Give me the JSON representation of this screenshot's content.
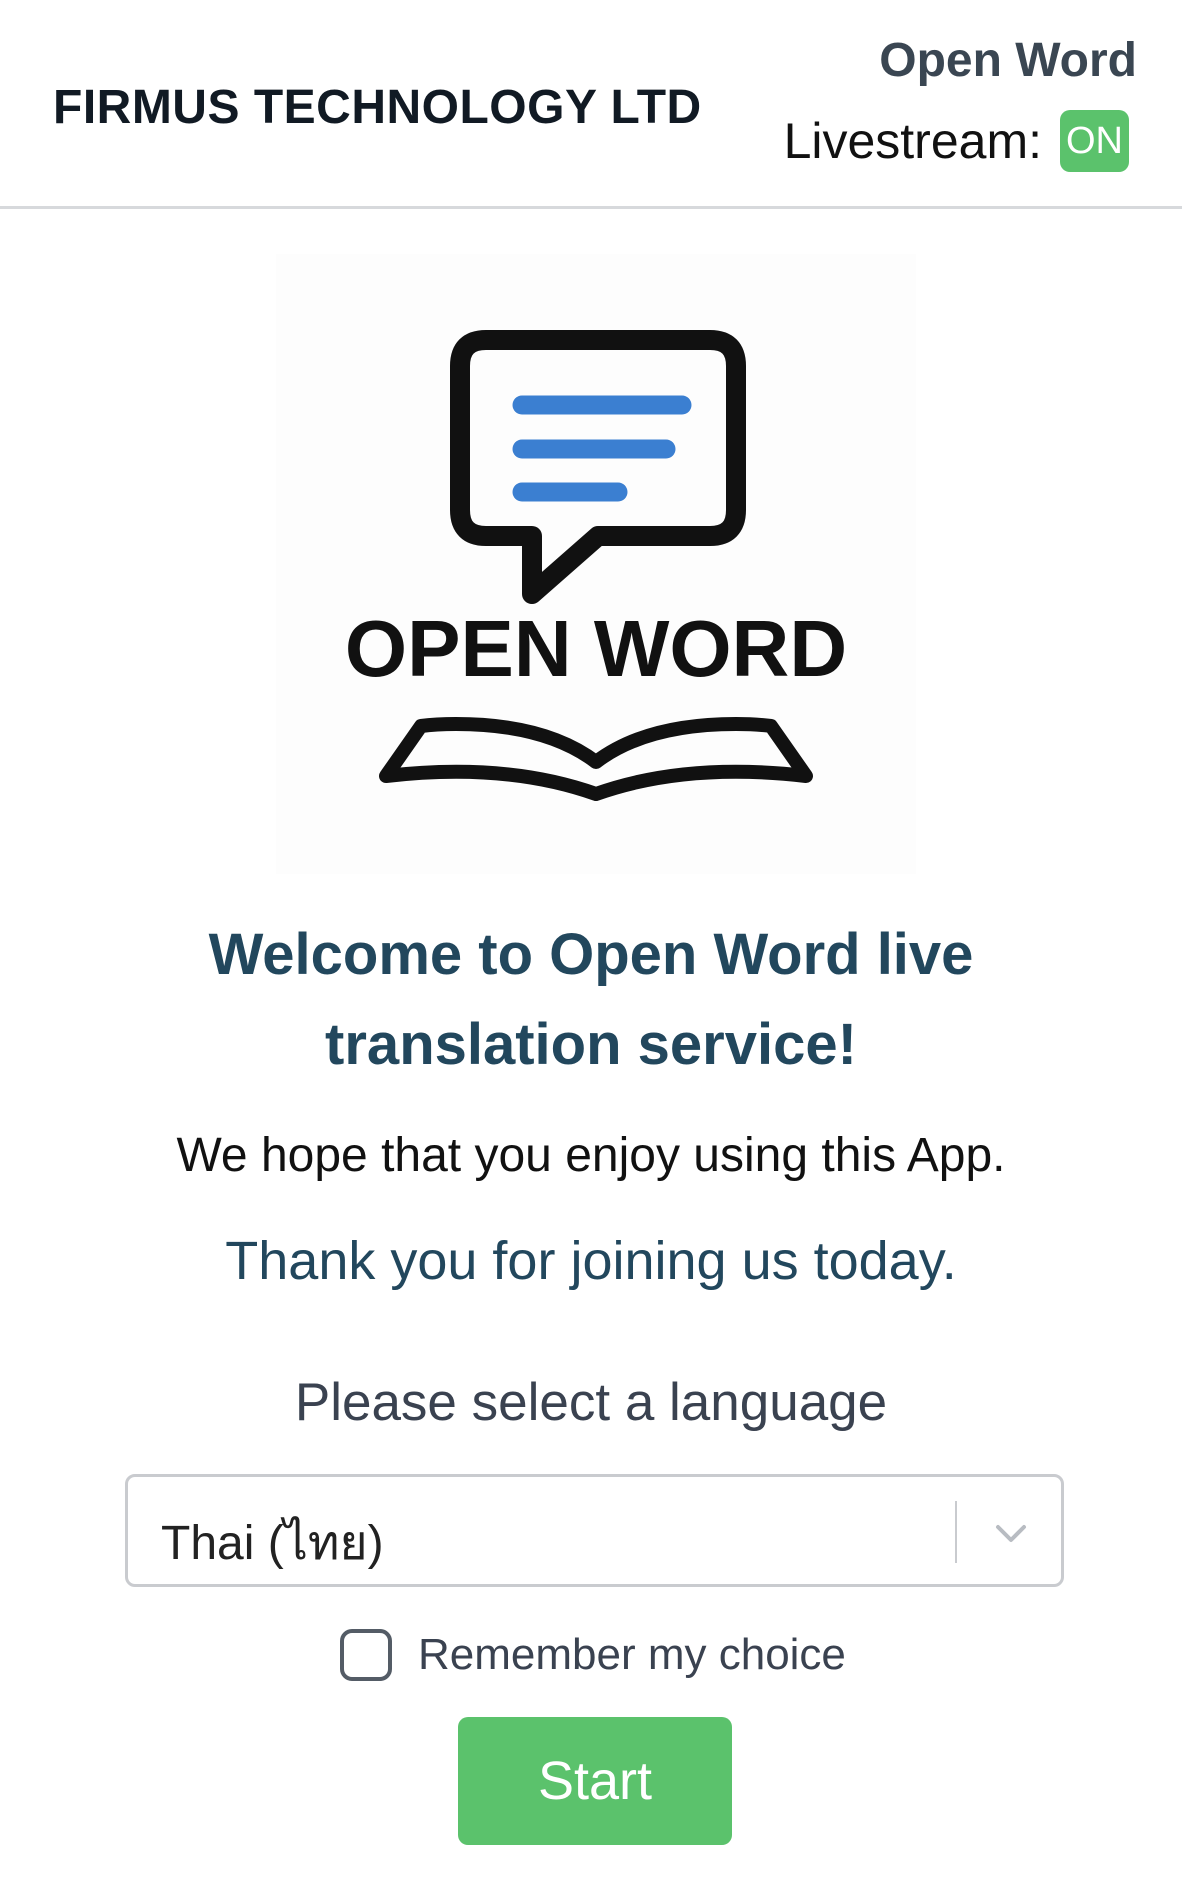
{
  "header": {
    "company": "FIRMUS TECHNOLOGY LTD",
    "app_name": "Open Word",
    "livestream_label": "Livestream:",
    "livestream_status": "ON"
  },
  "logo": {
    "title": "OPEN WORD"
  },
  "main": {
    "welcome": "Welcome to Open Word live translation service!",
    "enjoy": "We hope that you enjoy using this App.",
    "thanks": "Thank you for joining us today.",
    "select_prompt": "Please select a language",
    "language_selected": "Thai (ไทย)",
    "remember_label": "Remember my choice",
    "start_label": "Start"
  },
  "colors": {
    "accent_green": "#5bc26c",
    "heading_teal": "#22475d",
    "logo_blue": "#3b7fd1"
  },
  "icons": {
    "logo": "speech-bubble-with-book",
    "select": "chevron-down-icon"
  }
}
